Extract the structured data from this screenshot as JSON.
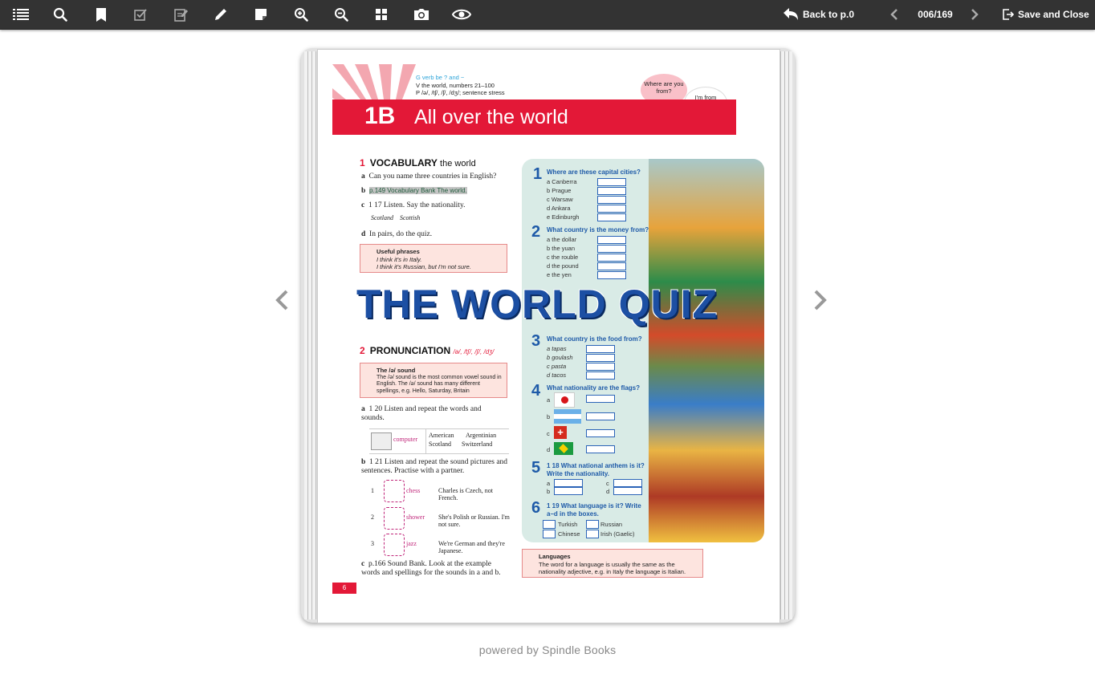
{
  "toolbar": {
    "back_label": "Back to p.0",
    "page_indicator": "006/169",
    "save_close_label": "Save and Close",
    "icons": [
      "menu-icon",
      "search-icon",
      "bookmark-icon",
      "checkbox-icon",
      "edit-notes-icon",
      "pencil-icon",
      "sticky-note-icon",
      "zoom-in-icon",
      "zoom-out-icon",
      "grid-icon",
      "camera-icon",
      "eye-icon",
      "back-arrow-icon",
      "prev-page-icon",
      "next-page-icon",
      "exit-icon"
    ]
  },
  "page": {
    "header": {
      "gvp_g": "G verb be ? and −",
      "gvp_v": "V the world, numbers 21–100",
      "gvp_p": "P /ə/, /tʃ/, /ʃ/, /dʒ/; sentence stress",
      "code": "1B",
      "title": "All over the world",
      "bubble_a": "Where are you from?",
      "bubble_b": "I'm from Ireland."
    },
    "vocab": {
      "num": "1",
      "title": "VOCABULARY",
      "sub": "the world",
      "a": "Can you name three countries in English?",
      "b": "p.149 Vocabulary Bank The world.",
      "c": "1 17 Listen. Say the nationality.",
      "c_ex1": "Scotland",
      "c_ex2": "Scottish",
      "d": "In pairs, do the quiz.",
      "useful_title": "Useful phrases",
      "useful_1": "I think it's in Italy.",
      "useful_2": "I think it's Russian, but I'm not sure."
    },
    "world_quiz_title": "THE WORLD QUIZ",
    "pron": {
      "num": "2",
      "title": "PRONUNCIATION",
      "sub": "/ə/, /tʃ/, /ʃ/, /dʒ/",
      "box_title": "The /ə/ sound",
      "box_text": "The /ə/ sound is the most common vowel sound in English. The /ə/ sound has many different spellings, e.g. Hello, Saturday, Britain",
      "a": "1 20 Listen and repeat the words and sounds.",
      "a_word": "computer",
      "a_words": [
        "American",
        "Argentinian",
        "Scotland",
        "Switzerland"
      ],
      "b": "1 21 Listen and repeat the sound pictures and sentences. Practise with a partner.",
      "rows": [
        {
          "n": "1",
          "word": "chess",
          "sent": "Charles is Czech, not French."
        },
        {
          "n": "2",
          "word": "shower",
          "sent": "She's Polish or Russian. I'm not sure."
        },
        {
          "n": "3",
          "word": "jazz",
          "sent": "We're German and they're Japanese."
        }
      ],
      "c": "p.166 Sound Bank. Look at the example words and spellings for the sounds in a and b."
    },
    "quiz": {
      "q1": {
        "n": "1",
        "title": "Where are these capital cities?",
        "items": [
          "a  Canberra",
          "b  Prague",
          "c  Warsaw",
          "d  Ankara",
          "e  Edinburgh"
        ]
      },
      "q2": {
        "n": "2",
        "title": "What country is the money from?",
        "items": [
          "a  the dollar",
          "b  the yuan",
          "c  the rouble",
          "d  the pound",
          "e  the yen"
        ]
      },
      "q3": {
        "n": "3",
        "title": "What country is the food from?",
        "items": [
          "a  tapas",
          "b  goulash",
          "c  pasta",
          "d  tacos"
        ]
      },
      "q4": {
        "n": "4",
        "title": "What nationality are the flags?",
        "items": [
          "a",
          "b",
          "c",
          "d"
        ]
      },
      "q5": {
        "n": "5",
        "title": "1 18  What national anthem is it? Write the nationality.",
        "items": [
          "a",
          "b",
          "c",
          "d"
        ]
      },
      "q6": {
        "n": "6",
        "title": "1 19  What language is it? Write a–d in the boxes.",
        "items": [
          "Turkish",
          "Russian",
          "Chinese",
          "Irish (Gaelic)"
        ]
      }
    },
    "languages_title": "Languages",
    "languages_text": "The word for a language is usually the same as the nationality adjective, e.g. in Italy the language is Italian.",
    "page_number": "6"
  },
  "footer": "powered by Spindle Books",
  "colors": {
    "toolbar": "#333333",
    "accent_red": "#e31837",
    "quiz_blue": "#1e5aa8"
  }
}
